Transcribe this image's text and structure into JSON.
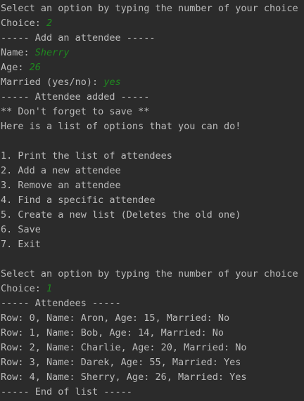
{
  "colors": {
    "background": "#2b2b2b",
    "output_text": "#bbbbbb",
    "user_input": "#1f8a1f"
  },
  "console": {
    "lines": [
      {
        "text": "Select an option by typing the number of your choice"
      },
      {
        "text": "Choice: ",
        "input": "2"
      },
      {
        "text": "----- Add an attendee -----"
      },
      {
        "text": "Name: ",
        "input": "Sherry"
      },
      {
        "text": "Age: ",
        "input": "26"
      },
      {
        "text": "Married (yes/no): ",
        "input": "yes"
      },
      {
        "text": "----- Attendee added -----"
      },
      {
        "text": "** Don't forget to save **"
      },
      {
        "text": "Here is a list of options that you can do!"
      },
      {
        "text": ""
      },
      {
        "text": "1. Print the list of attendees"
      },
      {
        "text": "2. Add a new attendee"
      },
      {
        "text": "3. Remove an attendee"
      },
      {
        "text": "4. Find a specific attendee"
      },
      {
        "text": "5. Create a new list (Deletes the old one)"
      },
      {
        "text": "6. Save"
      },
      {
        "text": "7. Exit"
      },
      {
        "text": ""
      },
      {
        "text": "Select an option by typing the number of your choice"
      },
      {
        "text": "Choice: ",
        "input": "1"
      },
      {
        "text": "----- Attendees -----"
      },
      {
        "text": "Row: 0, Name: Aron, Age: 15, Married: No"
      },
      {
        "text": "Row: 1, Name: Bob, Age: 14, Married: No"
      },
      {
        "text": "Row: 2, Name: Charlie, Age: 20, Married: No"
      },
      {
        "text": "Row: 3, Name: Darek, Age: 55, Married: Yes"
      },
      {
        "text": "Row: 4, Name: Sherry, Age: 26, Married: Yes"
      },
      {
        "text": "----- End of list -----"
      }
    ]
  }
}
